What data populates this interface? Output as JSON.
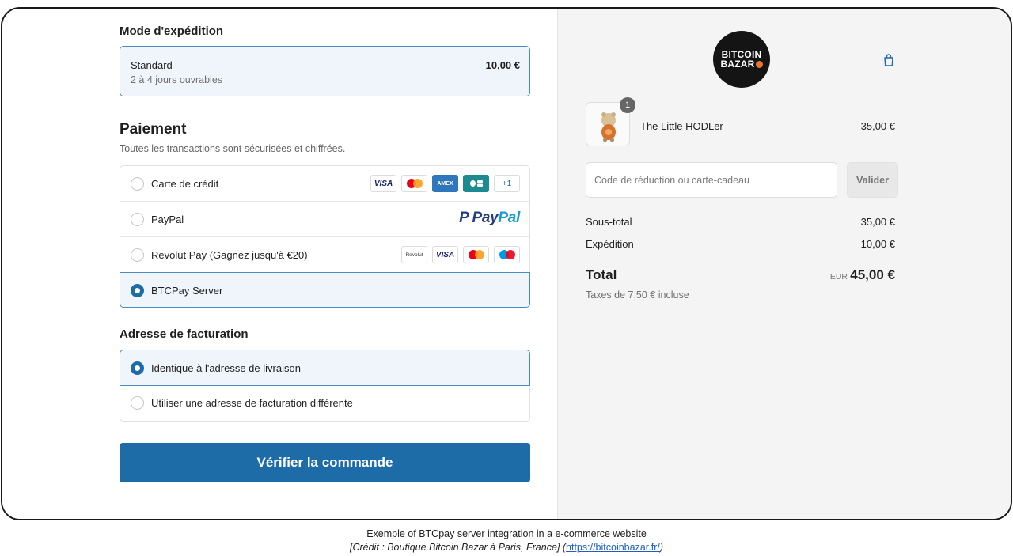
{
  "shipping": {
    "heading": "Mode d'expédition",
    "option_name": "Standard",
    "option_delay": "2 à 4 jours ouvrables",
    "option_price": "10,00 €"
  },
  "payment": {
    "heading": "Paiement",
    "subtitle": "Toutes les transactions sont sécurisées et chiffrées.",
    "methods": [
      {
        "label": "Carte de crédit",
        "selected": false,
        "badges": [
          "VISA",
          "mastercard",
          "AMEX",
          "CB",
          "+1"
        ]
      },
      {
        "label": "PayPal",
        "selected": false,
        "brand": {
          "p": "P",
          "pay": "Pay",
          "pal": "Pal"
        }
      },
      {
        "label": "Revolut Pay (Gagnez jusqu'à €20)",
        "selected": false,
        "badges": [
          "Revolut",
          "VISA",
          "mastercard",
          "maestro"
        ]
      },
      {
        "label": "BTCPay Server",
        "selected": true
      }
    ]
  },
  "billing": {
    "heading": "Adresse de facturation",
    "options": [
      {
        "label": "Identique à l'adresse de livraison",
        "selected": true
      },
      {
        "label": "Utiliser une adresse de facturation différente",
        "selected": false
      }
    ]
  },
  "cta_label": "Vérifier la commande",
  "summary": {
    "logo_line1": "BITCOIN",
    "logo_line2": "BAZAR",
    "product": {
      "name": "The Little HODLer",
      "qty": "1",
      "price": "35,00 €"
    },
    "discount_placeholder": "Code de réduction ou carte-cadeau",
    "apply_label": "Valider",
    "subtotal_label": "Sous-total",
    "subtotal_value": "35,00 €",
    "shipping_label": "Expédition",
    "shipping_value": "10,00 €",
    "total_label": "Total",
    "total_currency": "EUR",
    "total_value": "45,00 €",
    "tax_note": "Taxes de 7,50 € incluse"
  },
  "caption": {
    "line1": "Exemple of BTCpay server integration in a e-commerce website",
    "line2_prefix": "[Crédit : Boutique Bitcoin Bazar à Paris, France] (",
    "link": "https://bitcoinbazar.fr/",
    "line2_suffix": ")"
  },
  "colors": {
    "accent": "#1d6ca8",
    "selected_bg": "#f0f5fb",
    "selected_border": "#4a8cc2",
    "summary_bg": "#f4f4f4"
  }
}
